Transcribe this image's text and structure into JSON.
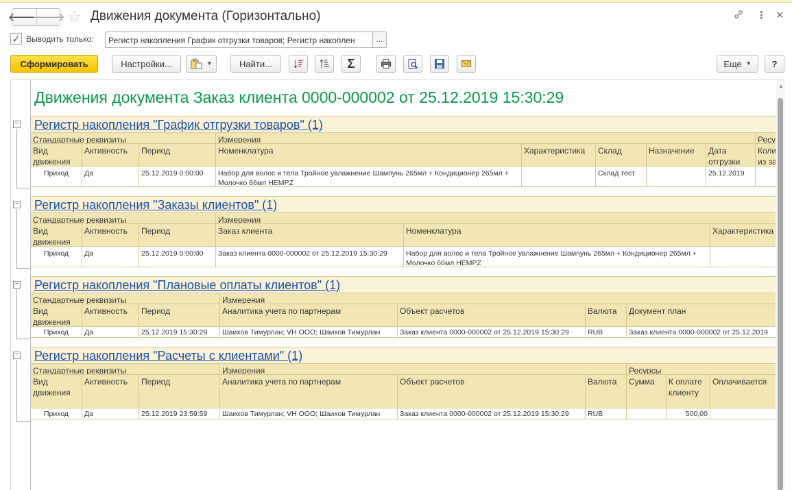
{
  "window": {
    "title": "Движения документа (Горизонтально)",
    "nav_back": "🡐",
    "nav_forward": "🡒",
    "star_icon": "☆",
    "link_icon": "🔗",
    "more_icon": "⋮",
    "close_icon": "✕"
  },
  "filter": {
    "checked": true,
    "label": "Выводить только:",
    "value": "Регистр накопления График отгрузки товаров; Регистр накоплен",
    "dots": "..."
  },
  "toolbar": {
    "generate": "Сформировать",
    "settings": "Настройки...",
    "find": "Найти...",
    "more": "Еще",
    "help": "?"
  },
  "report": {
    "title": "Движения документа Заказ клиента 0000-000002 от 25.12.2019 15:30:29",
    "sections": [
      {
        "title": "Регистр накопления \"График отгрузки товаров\" (1)",
        "groups": [
          "Стандартные реквизиты",
          "Измерения",
          "Ресу"
        ],
        "headers": [
          "Вид движения",
          "Активность",
          "Период",
          "Номенклатура",
          "Характеристика",
          "Склад",
          "Назначение",
          "Дата отгрузки",
          "Количество из за"
        ],
        "row": [
          "Приход",
          "Да",
          "25.12.2019 0:00:00",
          "Набор для волос и тела Тройное увлажнение Шампунь 265мл + Кондиционер 265мл + Молочко 66мл HEMPZ",
          "",
          "Склад тест",
          "",
          "25.12.2019",
          ""
        ]
      },
      {
        "title": "Регистр накопления \"Заказы клиентов\" (1)",
        "groups": [
          "Стандартные реквизиты",
          "Измерения"
        ],
        "headers": [
          "Вид движения",
          "Активность",
          "Период",
          "Заказ клиента",
          "Номенклатура",
          "Характеристика"
        ],
        "row": [
          "Приход",
          "Да",
          "25.12.2019 0:00:00",
          "Заказ клиента 0000-000002 от 25.12.2019 15:30:29",
          "Набор для волос и тела Тройное увлажнение Шампунь 265мл + Кондиционер 265мл + Молочко 66мл HEMPZ",
          ""
        ]
      },
      {
        "title": "Регистр накопления \"Плановые оплаты клиентов\" (1)",
        "groups": [
          "Стандартные реквизиты",
          "Измерения"
        ],
        "headers": [
          "Вид движения",
          "Активность",
          "Период",
          "Аналитика учета по партнерам",
          "Объект расчетов",
          "Валюта",
          "Документ план"
        ],
        "row": [
          "Приход",
          "Да",
          "25.12.2019 15:30:29",
          "Шаихов Тимурлан; VH ООО; Шаихов Тимурлан",
          "Заказ клиента 0000-000002 от 25.12.2019 15:30:29",
          "RUB",
          "Заказ клиента 0000-000002 от 25.12.2019"
        ]
      },
      {
        "title": "Регистр накопления \"Расчеты с клиентами\" (1)",
        "groups": [
          "Стандартные реквизиты",
          "Измерения",
          "Ресурсы"
        ],
        "headers": [
          "Вид движения",
          "Активность",
          "Период",
          "Аналитика учета по партнерам",
          "Объект расчетов",
          "Валюта",
          "Сумма",
          "К оплате клиенту",
          "Оплачивается"
        ],
        "row": [
          "Приход",
          "Да",
          "25.12.2019 23:59:59",
          "Шаихов Тимурлан; VH ООО; Шаихов Тимурлан",
          "Заказ клиента 0000-000002 от 25.12.2019 15:30:29",
          "RUB",
          "",
          "500,00",
          ""
        ]
      }
    ]
  }
}
